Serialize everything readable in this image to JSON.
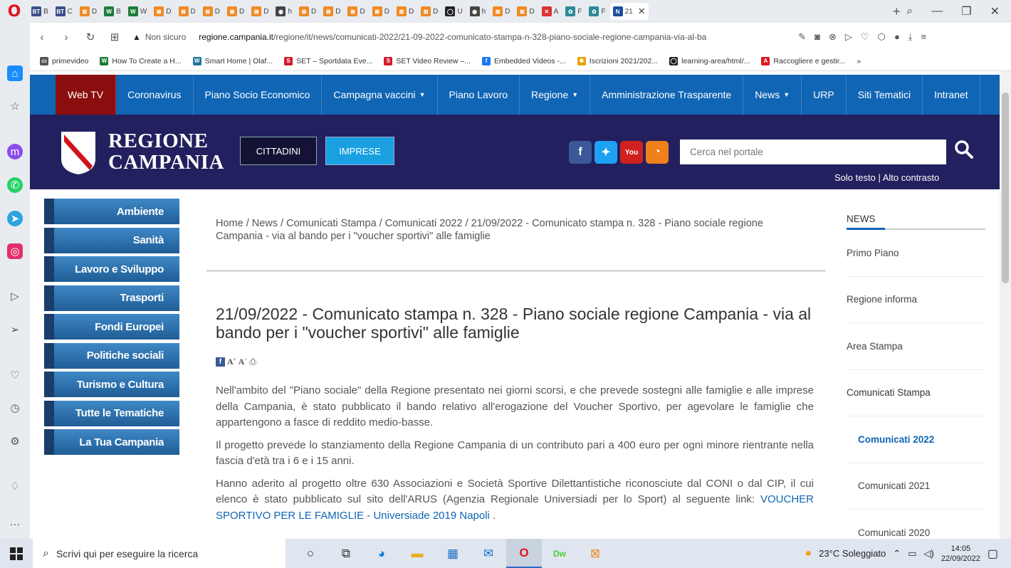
{
  "browser": {
    "tabs": [
      {
        "label": "B",
        "fav": "BT",
        "color": "#3a4f8a"
      },
      {
        "label": "C",
        "fav": "BT",
        "color": "#3a4f8a"
      },
      {
        "label": "D",
        "fav": "⊠",
        "color": "#f08a24"
      },
      {
        "label": "B",
        "fav": "W",
        "color": "#1c7c3a"
      },
      {
        "label": "W",
        "fav": "W",
        "color": "#1c7c3a"
      },
      {
        "label": "D",
        "fav": "⊠",
        "color": "#f08a24"
      },
      {
        "label": "D",
        "fav": "⊠",
        "color": "#f08a24"
      },
      {
        "label": "D",
        "fav": "⊠",
        "color": "#f08a24"
      },
      {
        "label": "D",
        "fav": "⊠",
        "color": "#f08a24"
      },
      {
        "label": "D",
        "fav": "⊠",
        "color": "#f08a24"
      },
      {
        "label": "h",
        "fav": "◉",
        "color": "#444"
      },
      {
        "label": "D",
        "fav": "⊠",
        "color": "#f08a24"
      },
      {
        "label": "D",
        "fav": "⊠",
        "color": "#f08a24"
      },
      {
        "label": "D",
        "fav": "⊠",
        "color": "#f08a24"
      },
      {
        "label": "D",
        "fav": "⊠",
        "color": "#f08a24"
      },
      {
        "label": "D",
        "fav": "⊠",
        "color": "#f08a24"
      },
      {
        "label": "D",
        "fav": "⊠",
        "color": "#f08a24"
      },
      {
        "label": "U",
        "fav": "◯",
        "color": "#222"
      },
      {
        "label": "h",
        "fav": "◉",
        "color": "#444"
      },
      {
        "label": "D",
        "fav": "⊠",
        "color": "#f08a24"
      },
      {
        "label": "D",
        "fav": "⊠",
        "color": "#f08a24"
      },
      {
        "label": "A",
        "fav": "✕",
        "color": "#d33"
      },
      {
        "label": "F",
        "fav": "✿",
        "color": "#2a8a9a"
      },
      {
        "label": "F",
        "fav": "✿",
        "color": "#2a8a9a"
      }
    ],
    "active_tab": {
      "label": "21",
      "fav": "N",
      "color": "#1a4fa0"
    },
    "insecure_label": "Non sicuro",
    "url_domain": "regione.campania.it",
    "url_path": "/regione/it/news/comunicati-2022/21-09-2022-comunicato-stampa-n-328-piano-sociale-regione-campania-via-al-ba",
    "bookmarks": [
      {
        "label": "primevideo",
        "icon": "folder-icon",
        "glyph": "▭",
        "color": "#555"
      },
      {
        "label": "How To Create a H...",
        "icon": "wikihow-icon",
        "glyph": "W",
        "color": "#1c7c3a"
      },
      {
        "label": "Smart Home | Olaf...",
        "icon": "wordpress-icon",
        "glyph": "W",
        "color": "#21759b"
      },
      {
        "label": "SET – Sportdata Eve...",
        "icon": "set-icon",
        "glyph": "S",
        "color": "#d01c2a"
      },
      {
        "label": "SET Video Review –...",
        "icon": "set-icon",
        "glyph": "S",
        "color": "#d01c2a"
      },
      {
        "label": "Embedded Videos -...",
        "icon": "facebook-icon",
        "glyph": "f",
        "color": "#1877f2"
      },
      {
        "label": "Iscrizioni 2021/202...",
        "icon": "sun-icon",
        "glyph": "✹",
        "color": "#e6a300"
      },
      {
        "label": "learning-area/html/...",
        "icon": "github-icon",
        "glyph": "◯",
        "color": "#222"
      },
      {
        "label": "Raccogliere e gestir...",
        "icon": "adobe-icon",
        "glyph": "A",
        "color": "#e0161e"
      }
    ]
  },
  "site": {
    "topnav": [
      {
        "label": "Web TV",
        "caret": false
      },
      {
        "label": "Coronavirus",
        "caret": false
      },
      {
        "label": "Piano Socio Economico",
        "caret": false
      },
      {
        "label": "Campagna vaccini",
        "caret": true
      },
      {
        "label": "Piano Lavoro",
        "caret": false
      },
      {
        "label": "Regione",
        "caret": true
      },
      {
        "label": "Amministrazione Trasparente",
        "caret": false
      },
      {
        "label": "News",
        "caret": true
      },
      {
        "label": "URP",
        "caret": false
      },
      {
        "label": "Siti Tematici",
        "caret": false
      },
      {
        "label": "Intranet",
        "caret": false
      }
    ],
    "logo_line1": "REGIONE",
    "logo_line2": "CAMPANIA",
    "btn_cittadini": "CITTADINI",
    "btn_imprese": "IMPRESE",
    "search_placeholder": "Cerca nel portale",
    "solo_testo": "Solo testo",
    "alto_contrasto": "Alto contrasto",
    "leftmenu": [
      "Ambiente",
      "Sanità",
      "Lavoro e Sviluppo",
      "Trasporti",
      "Fondi Europei",
      "Politiche sociali",
      "Turismo e Cultura",
      "Tutte le Tematiche",
      "La Tua Campania"
    ],
    "breadcrumb": "Home / News / Comunicati Stampa / Comunicati 2022 / 21/09/2022 - Comunicato stampa n. 328 - Piano sociale regione Campania - via al bando per i \"voucher sportivi\" alle famiglie",
    "title": "21/09/2022 - Comunicato stampa n. 328 - Piano sociale regione Campania - via al bando per i \"voucher sportivi\" alle famiglie",
    "paragraph1": "Nell'ambito del \"Piano sociale\" della Regione presentato nei giorni scorsi, e che prevede sostegni alle famiglie e alle imprese della Campania, è stato pubblicato il bando relativo all'erogazione del Voucher Sportivo, per agevolare le famiglie che appartengono a fasce di reddito medio-basse.",
    "paragraph2": "Il progetto prevede lo stanziamento della Regione Campania di un contributo pari a 400 euro per ogni minore rientrante nella fascia d'età tra i 6 e i 15 anni.",
    "paragraph3_before": "Hanno aderito al progetto oltre 630 Associazioni e Società Sportive Dilettantistiche riconosciute dal CONI o dal CIP, il cui elenco è stato pubblicato sul sito dell'ARUS (Agenzia Regionale Universiadi per lo Sport) al seguente link: ",
    "paragraph3_link": "VOUCHER SPORTIVO PER LE FAMIGLIE - Universiade 2019 Napoli",
    "paragraph3_after": " .",
    "rightcol": {
      "heading": "NEWS",
      "items": [
        {
          "label": "Primo Piano",
          "type": "normal"
        },
        {
          "label": "Regione informa",
          "type": "normal"
        },
        {
          "label": "Area Stampa",
          "type": "normal"
        },
        {
          "label": "Comunicati Stampa",
          "type": "bold"
        },
        {
          "label": "Comunicati 2022",
          "type": "current"
        },
        {
          "label": "Comunicati 2021",
          "type": "sub"
        },
        {
          "label": "Comunicati 2020",
          "type": "sub"
        }
      ]
    }
  },
  "taskbar": {
    "search_placeholder": "Scrivi qui per eseguire la ricerca",
    "weather": "23°C  Soleggiato",
    "time": "14:05",
    "date": "22/09/2022"
  },
  "colors": {
    "nav_blue": "#1065b4",
    "webtv_red": "#8b0e0e",
    "header_navy": "#22205e",
    "imprese_blue": "#1aa0e0"
  }
}
